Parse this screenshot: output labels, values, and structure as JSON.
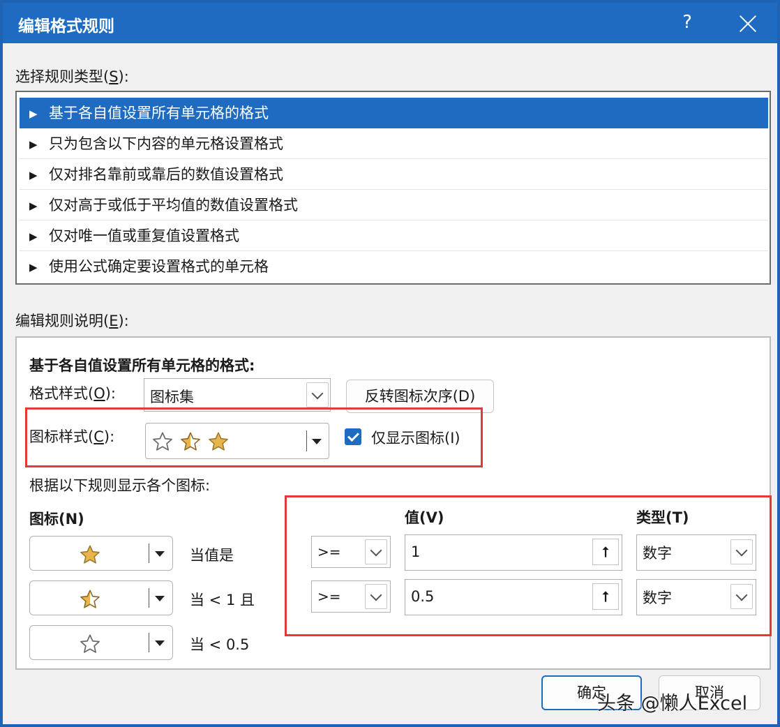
{
  "window": {
    "title": "编辑格式规则",
    "help_label": "?"
  },
  "rule_type": {
    "label": "选择规则类型(",
    "accel": "S",
    "label_end": "):",
    "items": [
      "基于各自值设置所有单元格的格式",
      "只为包含以下内容的单元格设置格式",
      "仅对排名靠前或靠后的数值设置格式",
      "仅对高于或低于平均值的数值设置格式",
      "仅对唯一值或重复值设置格式",
      "使用公式确定要设置格式的单元格"
    ],
    "selected_index": 0,
    "bullet": "▶"
  },
  "description": {
    "label": "编辑规则说明(",
    "accel": "E",
    "label_end": "):",
    "heading": "基于各自值设置所有单元格的格式:",
    "format_style": {
      "label": "格式样式(",
      "accel": "O",
      "label_end": "):",
      "value": "图标集"
    },
    "reverse_button": "反转图标次序(D)",
    "icon_style": {
      "label": "图标样式(",
      "accel": "C",
      "label_end": "):",
      "icons": [
        "empty-star-icon",
        "half-star-icon",
        "full-star-icon"
      ]
    },
    "show_icon_only": {
      "label": "仅显示图标(I)",
      "checked": true
    },
    "rules_caption": "根据以下规则显示各个图标:",
    "col_icon": "图标(N)",
    "col_value": "值(V)",
    "col_type": "类型(T)",
    "rows": [
      {
        "icon": "full-star-icon",
        "condition": "当值是",
        "operator": ">=",
        "value": "1",
        "type": "数字"
      },
      {
        "icon": "half-star-icon",
        "condition": "当 < 1 且",
        "operator": ">=",
        "value": "0.5",
        "type": "数字"
      },
      {
        "icon": "empty-star-icon",
        "condition": "当 < 0.5"
      }
    ]
  },
  "buttons": {
    "ok": "确定",
    "cancel": "取消"
  },
  "watermark": "头条 @懒人Excel",
  "colors": {
    "title_bar": "#1e6bc1",
    "selection": "#1e6bc1",
    "highlight_box": "#e53935",
    "star": "#e9b54a"
  }
}
